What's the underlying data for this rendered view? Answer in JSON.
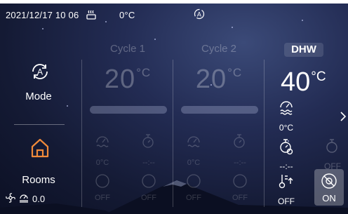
{
  "status_bar": {
    "datetime": "2021/12/17 10 06",
    "outdoor_temp": "0°C",
    "mode_glyph": "A"
  },
  "left_panel": {
    "mode_icon": "auto-cycle-icon",
    "mode_glyph": "A",
    "mode_label": "Mode",
    "rooms_icon": "home-icon",
    "rooms_label": "Rooms",
    "energy_value": "0.0"
  },
  "cycle1": {
    "title": "Cycle 1",
    "temp": "20",
    "unit": "°C",
    "labels": [
      "0°C",
      "--:--",
      "OFF",
      "OFF"
    ]
  },
  "cycle2": {
    "title": "Cycle 2",
    "temp": "20",
    "unit": "°C",
    "labels": [
      "0°C",
      "--:--",
      "OFF",
      "OFF"
    ]
  },
  "dhw": {
    "title": "DHW",
    "temp": "40",
    "unit": "°C",
    "tank_temp": "0°C",
    "timer": "--:--",
    "faded_label": "OFF",
    "boost_label": "OFF",
    "disinfect_label": "ON"
  },
  "colors": {
    "background": "#1a2244",
    "text": "#ffffff"
  }
}
